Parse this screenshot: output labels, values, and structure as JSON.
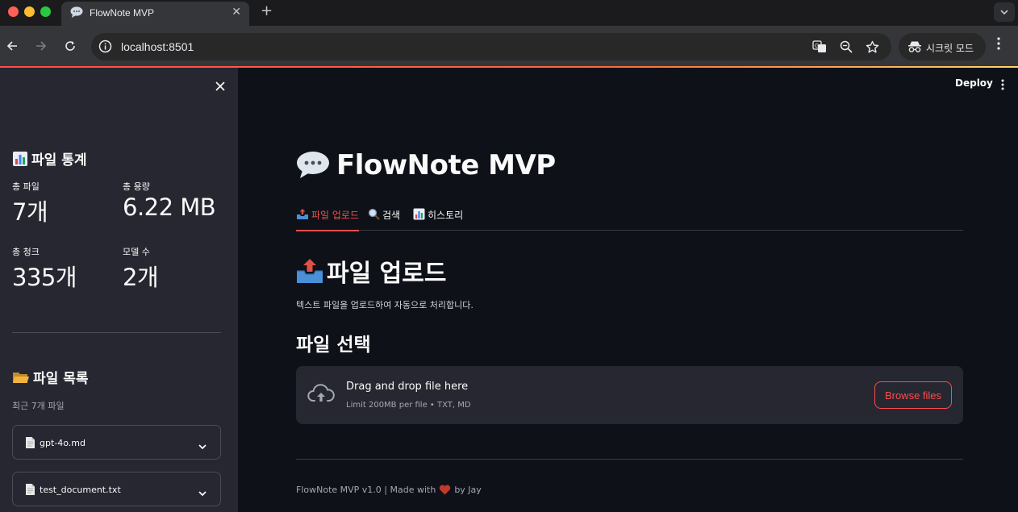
{
  "browser": {
    "tab_title": "FlowNote MVP",
    "favicon": "speech-bubble-icon",
    "url": "localhost:8501",
    "incognito_label": "시크릿 모드"
  },
  "sidebar": {
    "stats_heading": "파일 통계",
    "metrics": [
      {
        "label": "총 파일",
        "value": "7개"
      },
      {
        "label": "총 용량",
        "value": "6.22 MB"
      },
      {
        "label": "총 청크",
        "value": "335개"
      },
      {
        "label": "모델 수",
        "value": "2개"
      }
    ],
    "files_heading": "파일 목록",
    "files_caption": "최근 7개 파일",
    "files": [
      {
        "name": "gpt-4o.md"
      },
      {
        "name": "test_document.txt"
      }
    ]
  },
  "header": {
    "deploy_label": "Deploy"
  },
  "main": {
    "title": "FlowNote MVP",
    "tabs": [
      {
        "label": "파일 업로드",
        "icon": "outbox-tray-icon",
        "active": true
      },
      {
        "label": "검색",
        "icon": "magnifier-icon",
        "active": false
      },
      {
        "label": "히스토리",
        "icon": "bar-chart-icon",
        "active": false
      }
    ],
    "section_title": "파일 업로드",
    "section_desc": "텍스트 파일을 업로드하여 자동으로 처리합니다.",
    "uploader_title": "파일 선택",
    "dropzone": {
      "title": "Drag and drop file here",
      "subtitle": "Limit 200MB per file • TXT, MD",
      "button_label": "Browse files"
    },
    "footer": {
      "text_before": "FlowNote MVP v1.0 | Made with",
      "text_after": "by Jay"
    }
  },
  "colors": {
    "accent": "#ff4b4b",
    "sidebar_bg": "#262730",
    "main_bg": "#0e1117"
  }
}
